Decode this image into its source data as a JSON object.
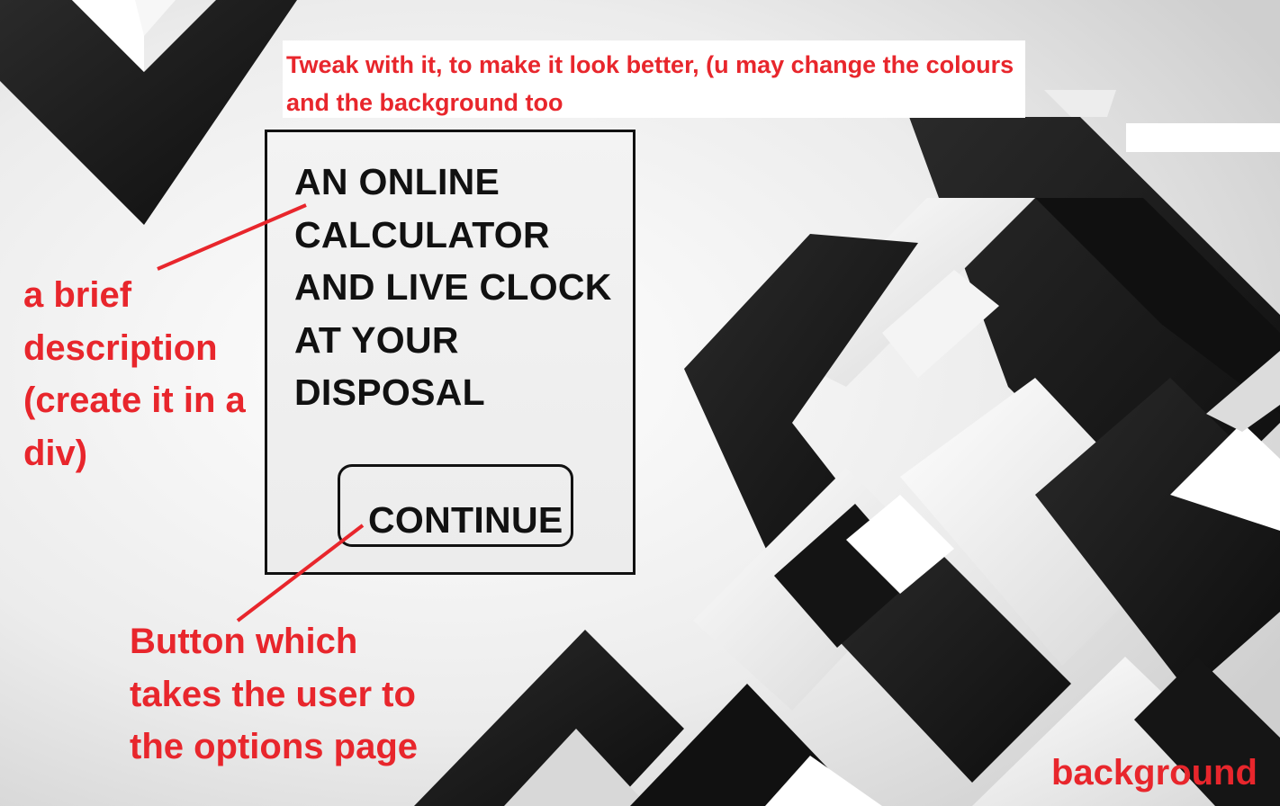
{
  "instruction_note": "Tweak with it, to make it look better, (u may change the colours and the background too",
  "card": {
    "title": "AN ONLINE CALCULATOR AND LIVE CLOCK AT YOUR DISPOSAL",
    "button_label": "CONTINUE"
  },
  "annotations": {
    "description_note": "a brief description (create it in a div)",
    "button_note": "Button which takes the user to the options page",
    "background_note": "background"
  },
  "colors": {
    "annotation_red": "#e8262c",
    "card_border": "#111111",
    "background_dark": "#1a1a1a",
    "background_light": "#f2f2f2"
  }
}
